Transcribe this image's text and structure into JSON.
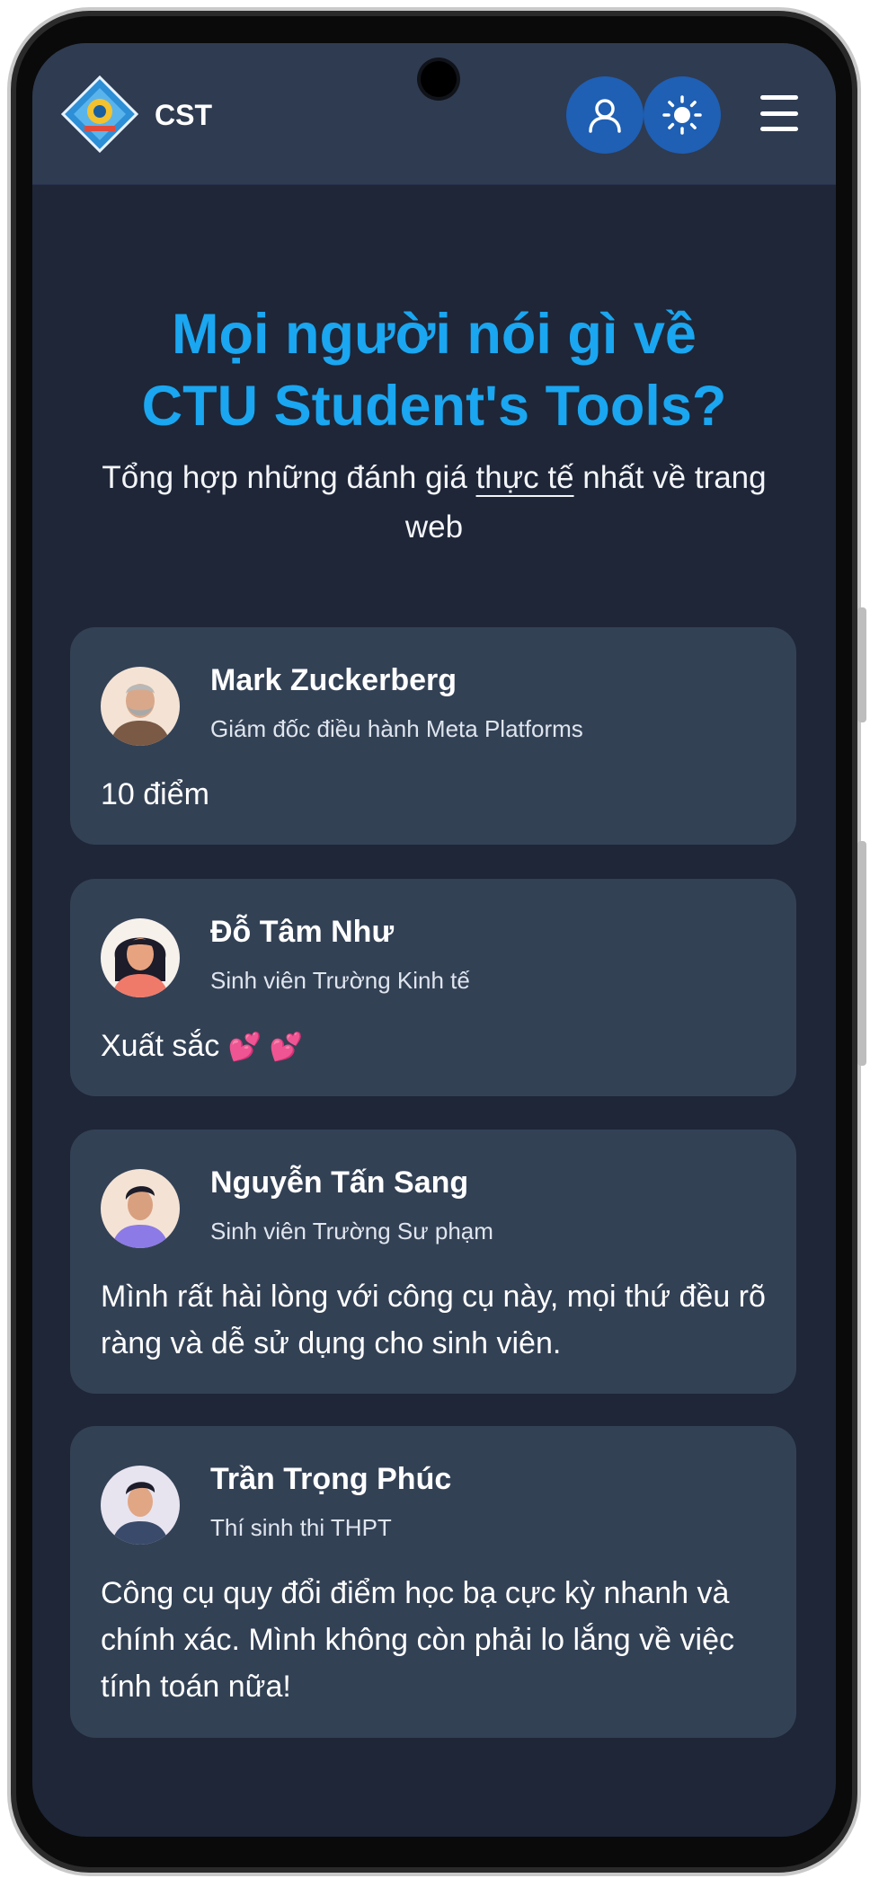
{
  "header": {
    "brand": "CST",
    "logo_icon": "ctu-logo-icon",
    "user_button_icon": "user-icon",
    "theme_button_icon": "sun-icon",
    "menu_icon": "hamburger-menu-icon"
  },
  "hero": {
    "title_line1": "Mọi người nói gì về",
    "title_line2": "CTU Student's Tools?",
    "subtitle_part1": "Tổng hợp những đánh giá ",
    "subtitle_highlight": "thực tế",
    "subtitle_part2": " nhất về trang web"
  },
  "testimonials": [
    {
      "name": "Mark Zuckerberg",
      "role": "Giám đốc điều hành Meta Platforms",
      "text": "10 điểm",
      "avatar_icon": "avatar-icon"
    },
    {
      "name": "Đỗ Tâm Như",
      "role": "Sinh viên Trường Kinh tế",
      "text": "Xuất sắc",
      "hearts": "💕 💕",
      "avatar_icon": "avatar-icon"
    },
    {
      "name": "Nguyễn Tấn Sang",
      "role": "Sinh viên Trường Sư phạm",
      "text": "Mình rất hài lòng với công cụ này, mọi thứ đều rõ ràng và dễ sử dụng cho sinh viên.",
      "avatar_icon": "avatar-icon"
    },
    {
      "name": "Trần Trọng Phúc",
      "role": "Thí sinh thi THPT",
      "text": "Công cụ quy đổi điểm học bạ cực kỳ nhanh và chính xác. Mình không còn phải lo lắng về việc tính toán nữa!",
      "avatar_icon": "avatar-icon"
    }
  ],
  "colors": {
    "background": "#1e2638",
    "header": "#2f3b50",
    "card": "#334155",
    "title": "#1aa6f0",
    "button": "#1f5fb4"
  }
}
